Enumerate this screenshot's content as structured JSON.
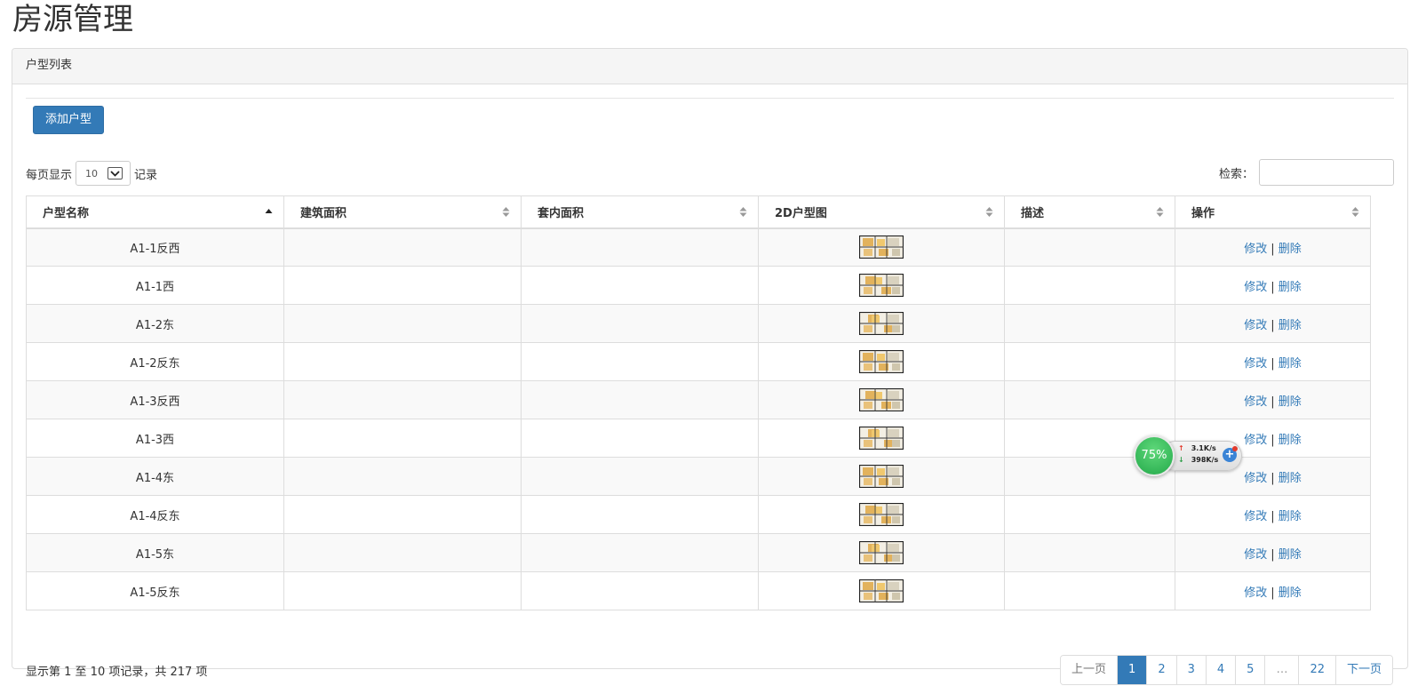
{
  "page": {
    "title": "房源管理"
  },
  "panel": {
    "heading": "户型列表"
  },
  "toolbar": {
    "add_label": "添加户型"
  },
  "length_menu": {
    "prefix": "每页显示",
    "value": "10",
    "suffix": "记录"
  },
  "search": {
    "label": "检索：",
    "value": ""
  },
  "table": {
    "columns": [
      {
        "label": "户型名称",
        "sort": "asc"
      },
      {
        "label": "建筑面积",
        "sort": "both"
      },
      {
        "label": "套内面积",
        "sort": "both"
      },
      {
        "label": "2D户型图",
        "sort": "both"
      },
      {
        "label": "描述",
        "sort": "both"
      },
      {
        "label": "操作",
        "sort": "both"
      }
    ],
    "edit_label": "修改",
    "separator": "|",
    "delete_label": "删除",
    "rows": [
      {
        "name": "A1-1反西",
        "area": "",
        "inner_area": "",
        "desc": ""
      },
      {
        "name": "A1-1西",
        "area": "",
        "inner_area": "",
        "desc": ""
      },
      {
        "name": "A1-2东",
        "area": "",
        "inner_area": "",
        "desc": ""
      },
      {
        "name": "A1-2反东",
        "area": "",
        "inner_area": "",
        "desc": ""
      },
      {
        "name": "A1-3反西",
        "area": "",
        "inner_area": "",
        "desc": ""
      },
      {
        "name": "A1-3西",
        "area": "",
        "inner_area": "",
        "desc": ""
      },
      {
        "name": "A1-4东",
        "area": "",
        "inner_area": "",
        "desc": ""
      },
      {
        "name": "A1-4反东",
        "area": "",
        "inner_area": "",
        "desc": ""
      },
      {
        "name": "A1-5东",
        "area": "",
        "inner_area": "",
        "desc": ""
      },
      {
        "name": "A1-5反东",
        "area": "",
        "inner_area": "",
        "desc": ""
      }
    ]
  },
  "info": {
    "text": "显示第 1 至 10 项记录，共 217 项"
  },
  "pagination": {
    "prev": "上一页",
    "pages": [
      "1",
      "2",
      "3",
      "4",
      "5"
    ],
    "ellipsis": "…",
    "last": "22",
    "next": "下一页",
    "active": "1"
  },
  "widget": {
    "percent": "75%",
    "up": "3.1K/s",
    "down": "398K/s"
  },
  "colors": {
    "primary": "#337ab7",
    "border": "#dddddd",
    "stripe": "#f9f9f9",
    "widget_green": "#23a94a"
  }
}
